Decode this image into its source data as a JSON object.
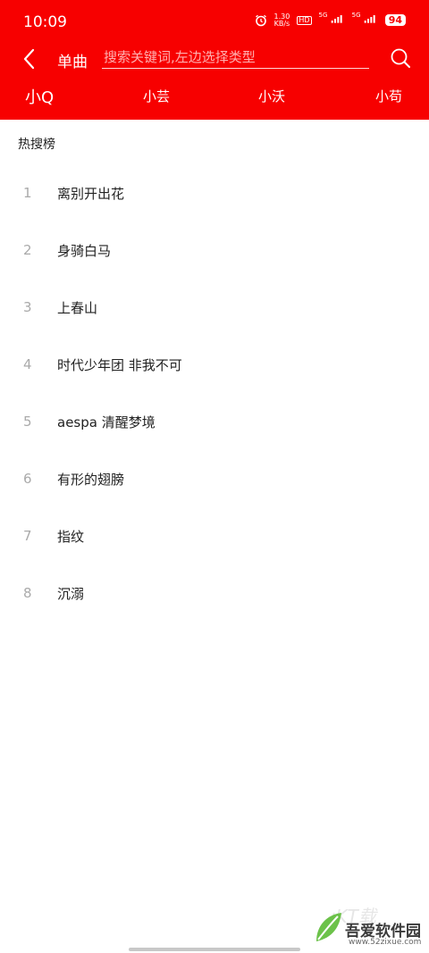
{
  "status_bar": {
    "time": "10:09",
    "net_speed_value": "1.30",
    "net_speed_unit": "KB/s",
    "hd_badge": "HD",
    "sim1_label": "5G",
    "sim2_label": "5G",
    "battery": "94"
  },
  "header": {
    "back_icon": "chevron-left-icon",
    "type_label": "单曲",
    "search_placeholder": "搜索关键词,左边选择类型",
    "search_icon": "search-icon",
    "background_color": "#f70000"
  },
  "tabs": [
    {
      "label": "小Q",
      "active": true
    },
    {
      "label": "小芸",
      "active": false
    },
    {
      "label": "小沃",
      "active": false
    },
    {
      "label": "小苟",
      "active": false
    }
  ],
  "hot_search": {
    "title": "热搜榜",
    "items": [
      {
        "rank": "1",
        "title": "离别开出花"
      },
      {
        "rank": "2",
        "title": "身骑白马"
      },
      {
        "rank": "3",
        "title": "上春山"
      },
      {
        "rank": "4",
        "title": "时代少年团 非我不可"
      },
      {
        "rank": "5",
        "title": "aespa 清醒梦境"
      },
      {
        "rank": "6",
        "title": "有形的翅膀"
      },
      {
        "rank": "7",
        "title": "指纹"
      },
      {
        "rank": "8",
        "title": "沉溺"
      }
    ]
  },
  "watermark": {
    "text": "吾爱软件园",
    "url": "www.52zixue.com",
    "ghost_text": "ıKT载"
  }
}
